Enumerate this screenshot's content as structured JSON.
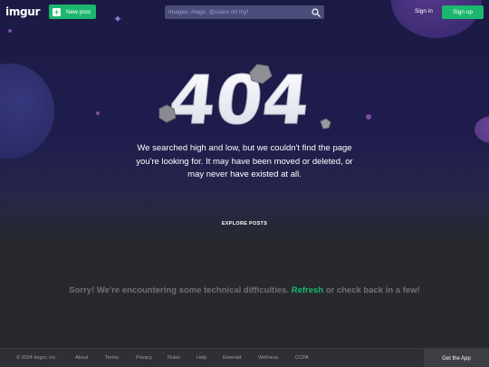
{
  "header": {
    "logo": "imgur",
    "new_post_label": "New post",
    "search_placeholder": "Images, #tags, @users oh my!",
    "sign_in_label": "Sign in",
    "sign_up_label": "Sign up"
  },
  "main": {
    "error_code": "404",
    "message_lines": [
      "We searched high and low, but we couldn't find the page",
      "you're looking for. It may have been moved or deleted, or",
      "may never have existed at all."
    ],
    "explore_label": "EXPLORE POSTS",
    "tech_error_prefix": "Sorry! We're encountering some technical difficulties. ",
    "tech_error_link": "Refresh",
    "tech_error_suffix": " or check back in a few!"
  },
  "footer": {
    "copyright": "© 2024 Imgur, Inc.",
    "links": [
      "About",
      "Terms",
      "Privacy",
      "Rules",
      "Help",
      "Emerald",
      "Wellness",
      "CCPA"
    ],
    "get_app_label": "Get the App"
  },
  "colors": {
    "accent_green": "#1bb76e",
    "hero_background": "#1b1a44",
    "page_background": "#27292d"
  }
}
